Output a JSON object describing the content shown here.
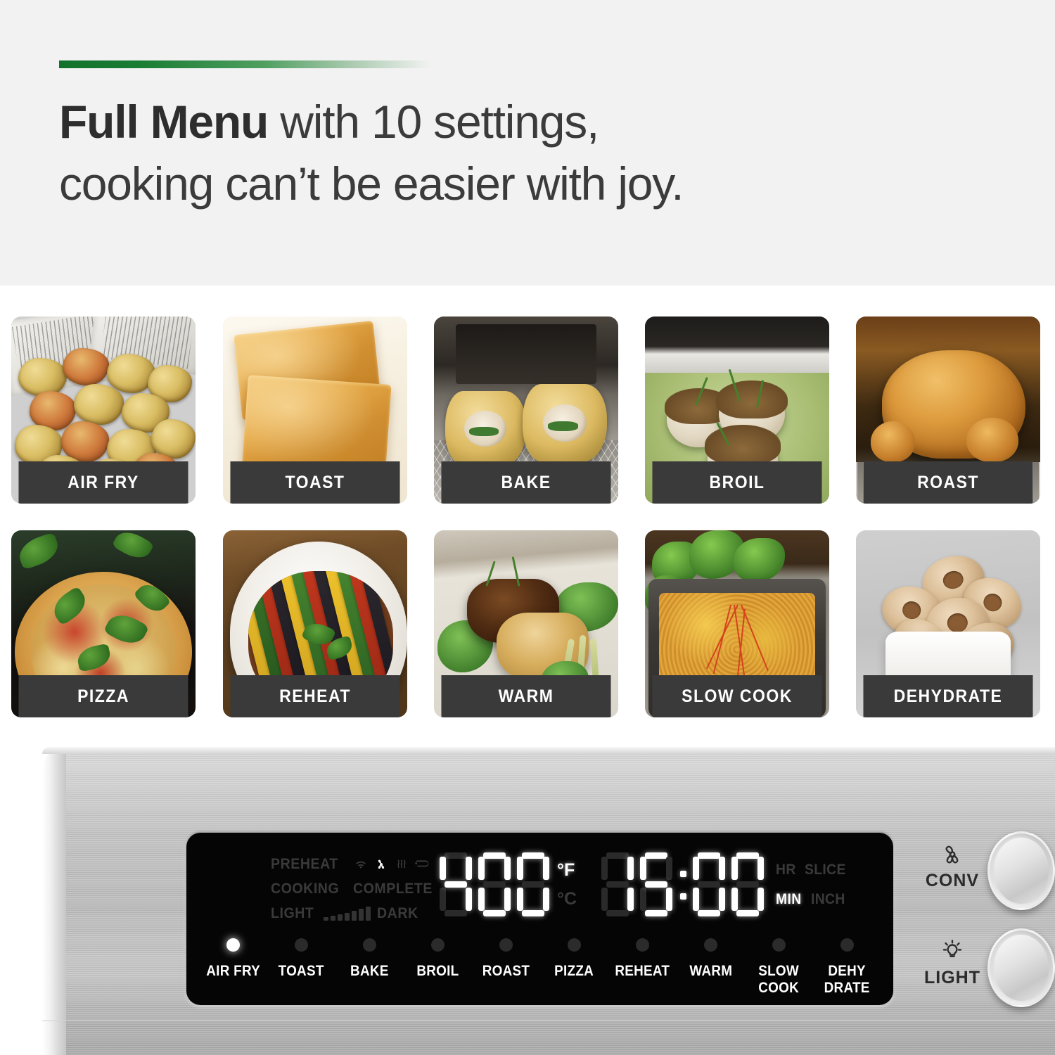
{
  "header": {
    "accent_color": "#12722c",
    "headline_bold": "Full Menu",
    "headline_rest": " with 10 settings,",
    "headline_line2": "cooking can’t be easier with joy."
  },
  "menu_tiles": [
    {
      "label": "AIR FRY",
      "photo": "breaded-nuggets-in-basket"
    },
    {
      "label": "TOAST",
      "photo": "two-golden-toast-slices"
    },
    {
      "label": "BAKE",
      "photo": "stuffed-chicken-roulade-on-rack"
    },
    {
      "label": "BROIL",
      "photo": "herbed-scallops-on-green-plate"
    },
    {
      "label": "ROAST",
      "photo": "whole-roast-chicken-in-oven"
    },
    {
      "label": "PIZZA",
      "photo": "vegetable-pizza-with-basil"
    },
    {
      "label": "REHEAT",
      "photo": "ratatouille-in-white-dish"
    },
    {
      "label": "WARM",
      "photo": "steak-with-greens"
    },
    {
      "label": "SLOW COOK",
      "photo": "cheesy-casserole-with-kale"
    },
    {
      "label": "DEHYDRATE",
      "photo": "dried-apple-chips-in-bowl"
    }
  ],
  "oven": {
    "display": {
      "status_labels": {
        "preheat": "PREHEAT",
        "cooking": "COOKING",
        "complete": "COMPLETE",
        "light": "LIGHT",
        "dark": "DARK"
      },
      "status_icons": [
        {
          "name": "wifi-icon",
          "lit": false
        },
        {
          "name": "fan-icon",
          "lit": true
        },
        {
          "name": "heat-waves-icon",
          "lit": false
        },
        {
          "name": "heating-element-icon",
          "lit": false
        }
      ],
      "doneness_bars": 7,
      "temperature": {
        "value": "400",
        "digits": [
          "4",
          "0",
          "0"
        ],
        "unit_f": "°F",
        "unit_c": "°C",
        "active_unit": "F"
      },
      "timer": {
        "value": "15:00",
        "digits": [
          "1",
          "5",
          "0",
          "0"
        ],
        "separator": ":"
      },
      "tail_labels": {
        "hr": "HR",
        "slice": "SLICE",
        "min": "MIN",
        "inch": "INCH",
        "active": "MIN"
      }
    },
    "modes": [
      {
        "label": "AIR FRY",
        "active": true
      },
      {
        "label": "TOAST",
        "active": false
      },
      {
        "label": "BAKE",
        "active": false
      },
      {
        "label": "BROIL",
        "active": false
      },
      {
        "label": "ROAST",
        "active": false
      },
      {
        "label": "PIZZA",
        "active": false
      },
      {
        "label": "REHEAT",
        "active": false
      },
      {
        "label": "WARM",
        "active": false
      },
      {
        "label": "SLOW\nCOOK",
        "active": false
      },
      {
        "label": "DEHY\nDRATE",
        "active": false
      }
    ],
    "knobs": [
      {
        "label": "CONV",
        "icon": "fan-icon"
      },
      {
        "label": "LIGHT",
        "icon": "light-bulb-icon"
      }
    ]
  }
}
